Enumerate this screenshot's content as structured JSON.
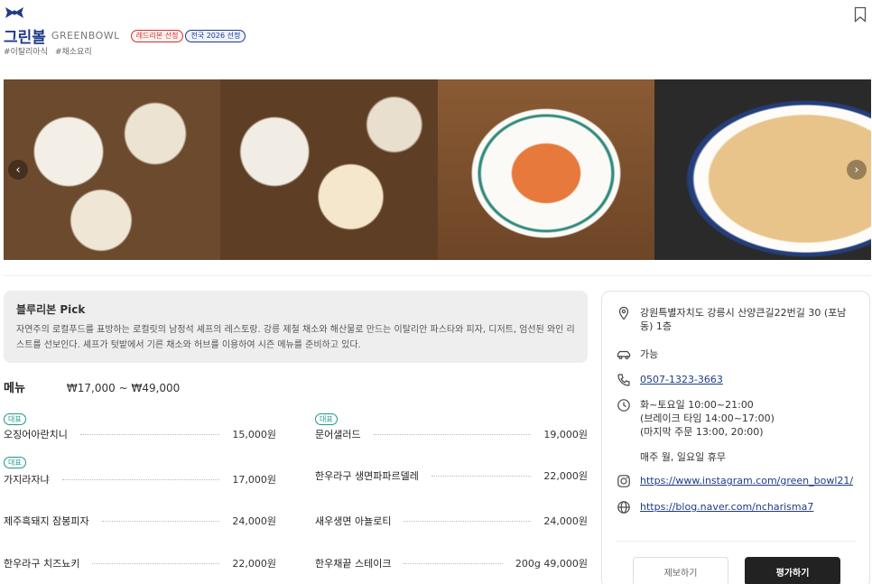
{
  "header": {
    "title_ko": "그린볼",
    "title_en": "GREENBOWL",
    "badges": [
      "레드리본 선정",
      "전국 2026 선정"
    ],
    "tags": [
      "#이탈리아식",
      "#채소요리"
    ]
  },
  "pick": {
    "title": "블루리본 Pick",
    "text": "자연주의 로컬푸드를 표방하는 로컬릿의 남정석 셰프의 레스토랑. 강릉 제철 채소와 해산물로 만드는 이탈리안 파스타와 피자, 디저트, 엄선된 와인 리스트를 선보인다. 셰프가 텃밭에서 기른 채소와 허브를 이용하여 시즌 메뉴를 준비하고 있다."
  },
  "menu": {
    "label": "메뉴",
    "price_range": "₩17,000 ~ ₩49,000",
    "rep_label": "대표",
    "items": [
      {
        "name": "오징어아란치니",
        "price": "15,000원"
      },
      {
        "name": "문어샐러드",
        "price": "19,000원"
      },
      {
        "name": "가지라자냐",
        "price": "17,000원"
      },
      {
        "name": "한우라구 생면파파르델레",
        "price": "22,000원"
      },
      {
        "name": "제주흑돼지 잠봉피자",
        "price": "24,000원"
      },
      {
        "name": "새우생면 아뇰로티",
        "price": "24,000원"
      },
      {
        "name": "한우라구 치즈뇨키",
        "price": "22,000원"
      },
      {
        "name": "한우채끝 스테이크",
        "price": "200g 49,000원"
      }
    ]
  },
  "info": {
    "address": "강원특별자치도 강릉시 산양큰길22번길 30 (포남동) 1층",
    "parking": "가능",
    "phone": "0507-1323-3663",
    "hours_1": "화~토요일 10:00~21:00",
    "hours_2": "(브레이크 타임 14:00~17:00)",
    "hours_3": "(마지막 주문 13:00, 20:00)",
    "closed": "매주 월, 일요일 휴무",
    "instagram": "https://www.instagram.com/green_bowl21/",
    "blog": "https://blog.naver.com/ncharisma7",
    "report_button": "제보하기",
    "rate_button": "평가하기"
  },
  "gallery": {
    "prev": "‹",
    "next": "›"
  },
  "colors": {
    "brand_blue": "#1f3b8a",
    "red_badge": "#d0312d",
    "rep_teal": "#1a9a8a"
  }
}
